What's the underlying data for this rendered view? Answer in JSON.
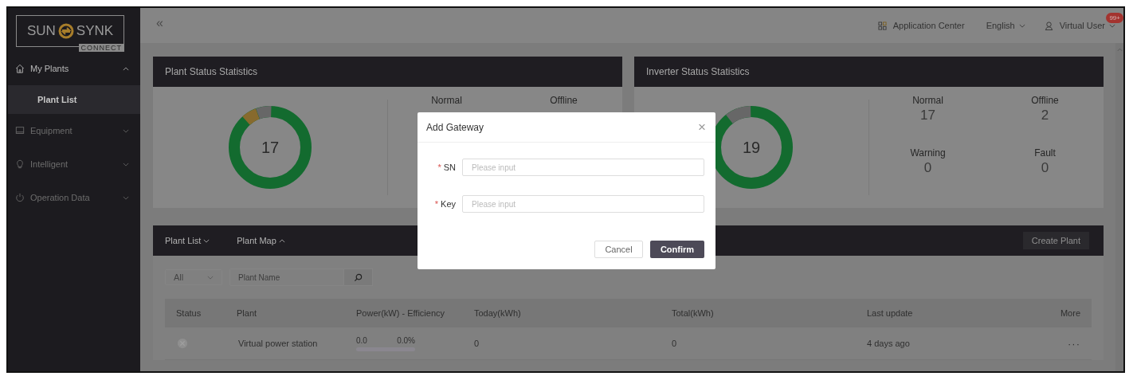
{
  "header": {
    "collapse": "«",
    "app_center": "Application Center",
    "language": "English",
    "user": "Virtual User",
    "badge": "99+"
  },
  "sidebar": {
    "logo": {
      "left": "SUN",
      "right": "SYNK",
      "sub": "CONNECT"
    },
    "items": [
      {
        "label": "My Plants",
        "expanded": true,
        "selected": false,
        "children": [
          {
            "label": "Plant List",
            "selected": true
          }
        ]
      },
      {
        "label": "Equipment",
        "expanded": false,
        "selected": false
      },
      {
        "label": "Intelligent",
        "expanded": false,
        "selected": false
      },
      {
        "label": "Operation Data",
        "expanded": false,
        "selected": false
      }
    ]
  },
  "plant_status": {
    "title": "Plant Status Statistics",
    "total": "17",
    "stats": [
      {
        "label": "Normal"
      },
      {
        "label": "Offline"
      }
    ]
  },
  "inverter_status": {
    "title": "Inverter Status Statistics",
    "total": "19",
    "stats": [
      {
        "label": "Normal",
        "value": "17"
      },
      {
        "label": "Offline",
        "value": "2"
      },
      {
        "label": "Warning",
        "value": "0"
      },
      {
        "label": "Fault",
        "value": "0"
      }
    ]
  },
  "plants": {
    "tabs": [
      {
        "label": "Plant List",
        "expanded": false
      },
      {
        "label": "Plant Map",
        "expanded": true
      }
    ],
    "create_button": "Create Plant",
    "filter": "All",
    "search": {
      "placeholder": "Plant Name"
    },
    "columns": [
      "Status",
      "Plant",
      "Power(kW) - Efficiency",
      "Today(kWh)",
      "Total(kWh)",
      "Last update",
      "More"
    ],
    "rows": [
      {
        "kind": "offline",
        "plant": "Virtual power station",
        "power": "0.0",
        "efficiency": "0.0%",
        "level": 0,
        "today": "0",
        "total": "0",
        "last_update": "4 days ago",
        "more": "···"
      }
    ]
  },
  "dialog": {
    "title": "Add Gateway",
    "close": "×",
    "fields": [
      {
        "label": "SN",
        "required_mark": "*",
        "placeholder": "Please input"
      },
      {
        "label": "Key",
        "required_mark": "*",
        "placeholder": "Please input"
      }
    ],
    "cancel": "Cancel",
    "confirm": "Confirm"
  }
}
